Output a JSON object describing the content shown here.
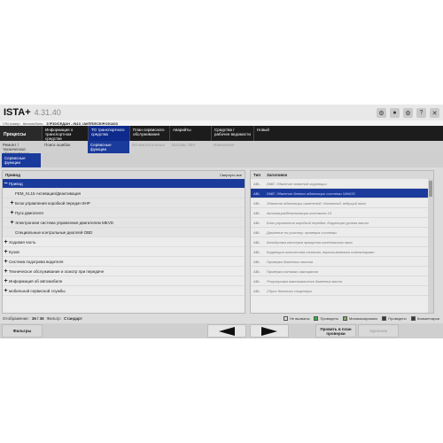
{
  "app": {
    "name": "ISTA+",
    "version": "4.31.40",
    "vin_label": "VIN-номер",
    "vehicle_label": "Автомобиль:",
    "vehicle_value": "3'/F30/СЕДАН - /N13_/АКПП/ЕСЕ/Р/201403"
  },
  "nav": {
    "main": "Процессы",
    "items": [
      "Информация о транспортном средстве",
      "ТО транспортного средства",
      "План сервисного обслуживания",
      "Аварийты",
      "Средства / рабочее ведомости",
      "Новый"
    ]
  },
  "subnav": {
    "items": [
      "Ремонт / техническое обслуживание",
      "Поиск ошибок",
      "Сервисные функции",
      "Вспомогательных",
      "Вызовы ЭБУ",
      "Изменение"
    ]
  },
  "third": {
    "tab": "Сервисные функции"
  },
  "left_panel": {
    "header": "Привод",
    "collapse_all": "Свернуть все",
    "rows": [
      {
        "label": "Привод",
        "toggle": "−"
      },
      {
        "label": "FEM_KL15 Активация/Деактивация",
        "toggle": ""
      },
      {
        "label": "Блок управления коробкой передач 8НР",
        "toggle": "+"
      },
      {
        "label": "Пуск двигателя",
        "toggle": "+"
      },
      {
        "label": "Электронная система управления двигателем MEVD",
        "toggle": "+"
      },
      {
        "label": "Специальные контрольные диоплей OBD",
        "toggle": ""
      },
      {
        "label": "Ходовая часть",
        "toggle": "+"
      },
      {
        "label": "Кузов",
        "toggle": "+"
      },
      {
        "label": "Система подогрева водителя",
        "toggle": "+"
      },
      {
        "label": "Техническое обслуживание и осмотр при передаче",
        "toggle": "+"
      },
      {
        "label": "Информация об автомобиле",
        "toggle": "+"
      },
      {
        "label": "мобильной сервисной службы",
        "toggle": "+"
      }
    ]
  },
  "right_panel": {
    "col_type": "Тип",
    "col_title": "Заголовок",
    "rows": [
      {
        "type": "ABL",
        "title": "DME: Удаление значений коррекции"
      },
      {
        "type": "ABL",
        "title": "DME: Удаление данных адаптации системы VANOS"
      },
      {
        "type": "ABL",
        "title": "Удаление адаптации изменений: Натяжной, ведущий вала"
      },
      {
        "type": "ABL",
        "title": "Активация/деактивация контакта 15"
      },
      {
        "type": "ABL",
        "title": "Блок управления коробкой передач: Коррекция уровня масла"
      },
      {
        "type": "ABL",
        "title": "Движение по участку: проверка системы"
      },
      {
        "type": "ABL",
        "title": "Калибровка кастеров вращения коленчатого вала"
      },
      {
        "type": "ABL",
        "title": "Коррекция количества топлива, впрыскиваемого инжекторами"
      },
      {
        "type": "ABL",
        "title": "Проверка давления сжатия"
      },
      {
        "type": "ABL",
        "title": "Проверка натяжки заксирания"
      },
      {
        "type": "ABL",
        "title": "Регулировка максимального давления масла"
      },
      {
        "type": "ABL",
        "title": "Сброс блочного стартера"
      }
    ]
  },
  "status": {
    "shown_label": "Отображение:",
    "shown_value": "36 / 36",
    "filter_label": "Фильтр:",
    "filter_value": "Стандарт",
    "legend": [
      "Не вызваны",
      "Проведено",
      "Минимизировано",
      "Проведено",
      "Комментарии"
    ]
  },
  "bottom": {
    "filters": "Фильтры",
    "test_plan": "Провить в план проверки",
    "disabled": "Удаление"
  }
}
